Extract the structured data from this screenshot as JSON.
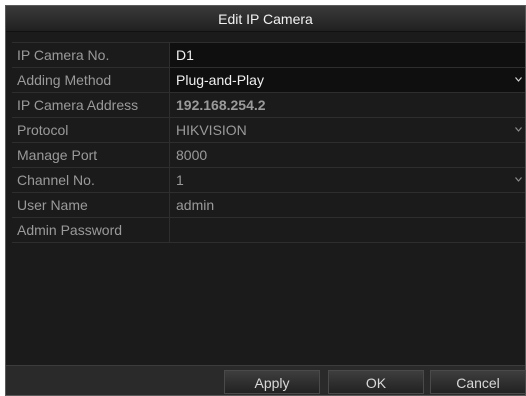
{
  "dialog": {
    "title": "Edit IP Camera"
  },
  "form": {
    "rows": [
      {
        "label": "IP Camera No.",
        "value": "D1"
      },
      {
        "label": "Adding Method",
        "value": "Plug-and-Play"
      },
      {
        "label": "IP Camera Address",
        "value": "192.168.254.2"
      },
      {
        "label": "Protocol",
        "value": "HIKVISION"
      },
      {
        "label": "Manage Port",
        "value": "8000"
      },
      {
        "label": "Channel No.",
        "value": "1"
      },
      {
        "label": "User Name",
        "value": "admin"
      },
      {
        "label": "Admin Password",
        "value": ""
      }
    ]
  },
  "buttons": {
    "apply": "Apply",
    "ok": "OK",
    "cancel": "Cancel"
  },
  "icons": {
    "dropdown": "chevron-down-icon"
  },
  "colors": {
    "background": "#1b1b1b",
    "text_active": "#f0f0f0",
    "text_disabled": "#9a9a9a"
  }
}
